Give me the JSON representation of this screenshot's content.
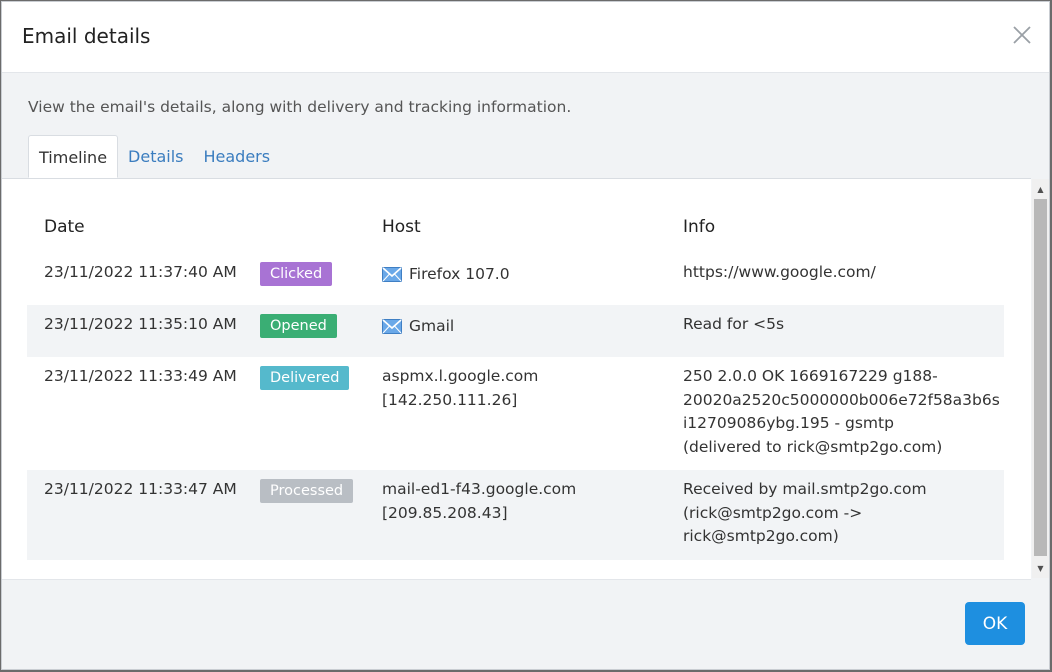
{
  "dialog": {
    "title": "Email details",
    "intro": "View the email's details, along with delivery and tracking information."
  },
  "tabs": [
    {
      "label": "Timeline",
      "active": true
    },
    {
      "label": "Details",
      "active": false
    },
    {
      "label": "Headers",
      "active": false
    }
  ],
  "timeline": {
    "columns": {
      "date": "Date",
      "host": "Host",
      "info": "Info"
    },
    "rows": [
      {
        "date": "23/11/2022 11:37:40 AM",
        "status": "Clicked",
        "status_color": "#a873d4",
        "host_icon": "mail-icon",
        "host": [
          "Firefox 107.0"
        ],
        "info": [
          "https://www.google.com/"
        ]
      },
      {
        "date": "23/11/2022 11:35:10 AM",
        "status": "Opened",
        "status_color": "#3aae74",
        "host_icon": "mail-icon",
        "host": [
          "Gmail"
        ],
        "info": [
          "Read for <5s"
        ]
      },
      {
        "date": "23/11/2022 11:33:49 AM",
        "status": "Delivered",
        "status_color": "#55b9cc",
        "host_icon": "",
        "host": [
          "aspmx.l.google.com",
          "[142.250.111.26]"
        ],
        "info": [
          "250 2.0.0 OK 1669167229 g188-",
          "20020a2520c5000000b006e72f58a3b6s",
          "i12709086ybg.195 - gsmtp",
          "(delivered to rick@smtp2go.com)"
        ]
      },
      {
        "date": "23/11/2022 11:33:47 AM",
        "status": "Processed",
        "status_color": "#b9bec4",
        "host_icon": "",
        "host": [
          "mail-ed1-f43.google.com",
          "[209.85.208.43]"
        ],
        "info": [
          "Received by mail.smtp2go.com",
          "(rick@smtp2go.com ->",
          "rick@smtp2go.com)"
        ]
      }
    ]
  },
  "footer": {
    "ok_label": "OK"
  },
  "colors": {
    "primary": "#1e8fe0",
    "link": "#3b7dbf"
  }
}
